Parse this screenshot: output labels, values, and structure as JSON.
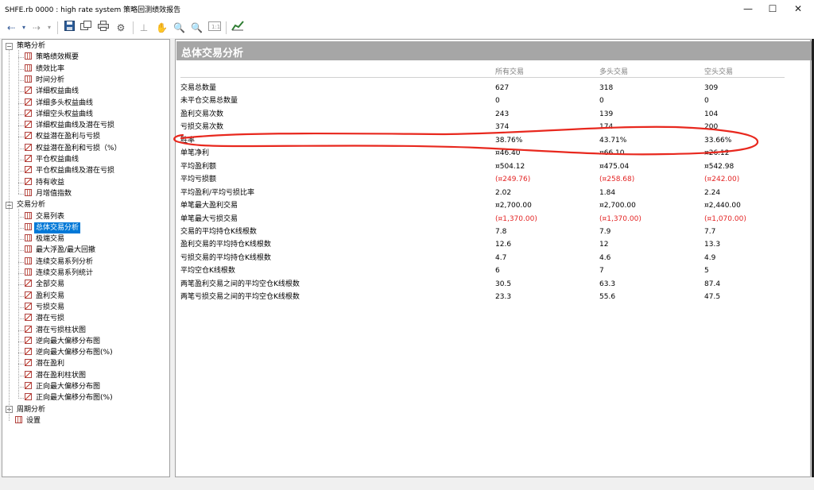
{
  "window": {
    "title": "SHFE.rb 0000 : high rate system 策略回测绩效报告",
    "min_glyph": "—",
    "max_glyph": "☐",
    "close_glyph": "✕"
  },
  "toolbar": {
    "icons": [
      "back-arrow-icon",
      "dropdown-icon",
      "forward-arrow-icon",
      "dropdown-icon",
      "save-icon",
      "copy-icon",
      "print-icon",
      "settings-icon",
      "crosshair-icon",
      "hand-icon",
      "zoom-in-icon",
      "zoom-out-icon",
      "zoom-fit-icon",
      "chart-icon"
    ]
  },
  "tree": {
    "groups": [
      {
        "label": "策略分析",
        "expanded": true,
        "items": [
          "策略绩效概要",
          "绩效比率",
          "时间分析",
          "详细权益曲线",
          "详细多头权益曲线",
          "详细空头权益曲线",
          "详细权益曲线及潜在亏损",
          "权益潜在盈利与亏损",
          "权益潜在盈利和亏损（%）",
          "平仓权益曲线",
          "平仓权益曲线及潜在亏损",
          "持有收益",
          "月增值指数"
        ]
      },
      {
        "label": "交易分析",
        "expanded": true,
        "items": [
          "交易列表",
          "总体交易分析",
          "极端交易",
          "最大浮盈/最大回撤",
          "连续交易系列分析",
          "连续交易系列统计",
          "全部交易",
          "盈利交易",
          "亏损交易",
          "潜在亏损",
          "潜在亏损柱状图",
          "逆向最大偏移分布图",
          "逆向最大偏移分布图(%)",
          "潜在盈利",
          "潜在盈利柱状图",
          "正向最大偏移分布图",
          "正向最大偏移分布图(%)"
        ]
      },
      {
        "label": "周期分析",
        "expanded": false,
        "items": []
      }
    ],
    "settings_label": "设置",
    "selected": "总体交易分析"
  },
  "report": {
    "title": "总体交易分析",
    "columns": [
      "所有交易",
      "多头交易",
      "空头交易"
    ],
    "rows": [
      {
        "label": "交易总数量",
        "values": [
          "627",
          "318",
          "309"
        ],
        "neg": [
          false,
          false,
          false
        ]
      },
      {
        "label": "未平仓交易总数量",
        "values": [
          "0",
          "0",
          "0"
        ],
        "neg": [
          false,
          false,
          false
        ]
      },
      {
        "label": "盈利交易次数",
        "values": [
          "243",
          "139",
          "104"
        ],
        "neg": [
          false,
          false,
          false
        ]
      },
      {
        "label": "亏损交易次数",
        "values": [
          "374",
          "174",
          "200"
        ],
        "neg": [
          false,
          false,
          false
        ]
      },
      {
        "label": "胜率",
        "values": [
          "38.76%",
          "43.71%",
          "33.66%"
        ],
        "neg": [
          false,
          false,
          false
        ]
      },
      {
        "label": "单笔净利",
        "values": [
          "¤46.40",
          "¤66.10",
          "¤26.12"
        ],
        "neg": [
          false,
          false,
          false
        ]
      },
      {
        "label": "平均盈利额",
        "values": [
          "¤504.12",
          "¤475.04",
          "¤542.98"
        ],
        "neg": [
          false,
          false,
          false
        ]
      },
      {
        "label": "平均亏损额",
        "values": [
          "(¤249.76)",
          "(¤258.68)",
          "(¤242.00)"
        ],
        "neg": [
          true,
          true,
          true
        ]
      },
      {
        "label": "平均盈利/平均亏损比率",
        "values": [
          "2.02",
          "1.84",
          "2.24"
        ],
        "neg": [
          false,
          false,
          false
        ]
      },
      {
        "label": "单笔最大盈利交易",
        "values": [
          "¤2,700.00",
          "¤2,700.00",
          "¤2,440.00"
        ],
        "neg": [
          false,
          false,
          false
        ]
      },
      {
        "label": "单笔最大亏损交易",
        "values": [
          "(¤1,370.00)",
          "(¤1,370.00)",
          "(¤1,070.00)"
        ],
        "neg": [
          true,
          true,
          true
        ]
      },
      {
        "label": "交易的平均持仓K线根数",
        "values": [
          "7.8",
          "7.9",
          "7.7"
        ],
        "neg": [
          false,
          false,
          false
        ]
      },
      {
        "label": "盈利交易的平均持仓K线根数",
        "values": [
          "12.6",
          "12",
          "13.3"
        ],
        "neg": [
          false,
          false,
          false
        ]
      },
      {
        "label": "亏损交易的平均持仓K线根数",
        "values": [
          "4.7",
          "4.6",
          "4.9"
        ],
        "neg": [
          false,
          false,
          false
        ]
      },
      {
        "label": "平均空仓K线根数",
        "values": [
          "6",
          "7",
          "5"
        ],
        "neg": [
          false,
          false,
          false
        ]
      },
      {
        "label": "两笔盈利交易之间的平均空仓K线根数",
        "values": [
          "30.5",
          "63.3",
          "87.4"
        ],
        "neg": [
          false,
          false,
          false
        ]
      },
      {
        "label": "两笔亏损交易之间的平均空仓K线根数",
        "values": [
          "23.3",
          "55.6",
          "47.5"
        ],
        "neg": [
          false,
          false,
          false
        ]
      }
    ]
  },
  "colors": {
    "negative": "#e32424",
    "header": "#a6a6a6",
    "selection": "#0078d7",
    "annotation": "#e8281e"
  }
}
